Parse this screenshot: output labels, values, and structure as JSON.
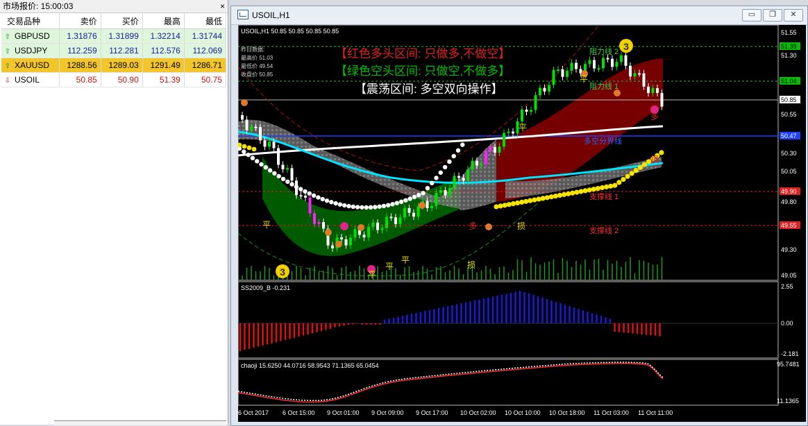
{
  "market_watch": {
    "title": "市场报价: 15:00:03",
    "close_glyph": "×",
    "columns": [
      "交易品种",
      "卖价",
      "买价",
      "最高",
      "最低"
    ],
    "rows": [
      {
        "symbol": "GBPUSD",
        "dir": "up",
        "bid": "1.31876",
        "ask": "1.31899",
        "high": "1.32214",
        "low": "1.31744"
      },
      {
        "symbol": "USDJPY",
        "dir": "up",
        "bid": "112.259",
        "ask": "112.281",
        "high": "112.576",
        "low": "112.069"
      },
      {
        "symbol": "XAUUSD",
        "dir": "up",
        "bid": "1288.56",
        "ask": "1289.03",
        "high": "1291.49",
        "low": "1286.71"
      },
      {
        "symbol": "USOIL",
        "dir": "down",
        "bid": "50.85",
        "ask": "50.90",
        "high": "51.39",
        "low": "50.75"
      }
    ]
  },
  "chart_window": {
    "title": "USOIL,H1",
    "min_glyph": "▭",
    "max_glyph": "❐",
    "close_glyph": "✕",
    "header": "USOIL,H1  50.85 50.85 50.85 50.85",
    "info": [
      "昨日数据:",
      "最高价 51.03",
      "最低价 49.54",
      "收盘价 50.85"
    ],
    "zones": [
      "【红色多头区间: 只做多,不做空】",
      "【绿色空头区间: 只做空,不做多】",
      "【震荡区间: 多空双向操作】"
    ],
    "level_labels": [
      "阻力线 2",
      "阻力线 1",
      "多空分界线",
      "支撑线 1",
      "支撑线 2"
    ],
    "marks": {
      "ping": "平",
      "duo": "多",
      "sun": "损"
    },
    "price_ticks": [
      "51.55",
      "51.30",
      "51.04",
      "50.85",
      "50.55",
      "50.30",
      "50.05",
      "49.80",
      "49.55",
      "49.30",
      "49.05"
    ],
    "price_badges": {
      "r2": "51.39",
      "r1": "51.04",
      "cur": "50.85",
      "mid": "50.47",
      "s1": "49.90",
      "s2": "49.55"
    },
    "ind1": {
      "label": "SS2009_B -0.231",
      "ticks": [
        "2.55",
        "0.00",
        "-2.181"
      ]
    },
    "ind2": {
      "label": "chaoji 15.6250 44.0716 58.9543 71.1365 65.0454",
      "ticks": [
        "95.7481",
        "11.1365"
      ]
    },
    "time_ticks": [
      "6 Oct 2017",
      "6 Oct 15:00",
      "9 Oct 01:00",
      "9 Oct 09:00",
      "9 Oct 17:00",
      "10 Oct 02:00",
      "10 Oct 10:00",
      "10 Oct 18:00",
      "11 Oct 03:00",
      "11 Oct 11:00"
    ],
    "colors": {
      "bull": "#00e000",
      "bear": "#ffffff",
      "up_zone": "#8b0000",
      "down_zone": "#006400",
      "neutral_zone": "#808080",
      "ma_cyan": "#00e5ff",
      "histo_pos": "#1a1adc",
      "histo_neg": "#e01010"
    }
  }
}
